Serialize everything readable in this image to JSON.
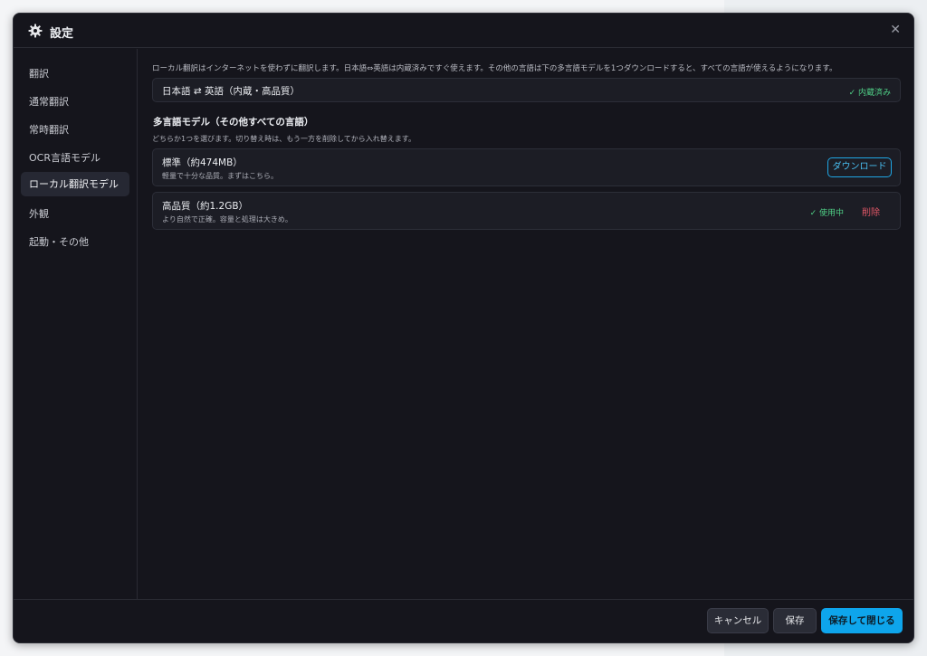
{
  "window": {
    "title": "設定",
    "close_glyph": "✕"
  },
  "sidebar": {
    "items": [
      {
        "label": "翻訳"
      },
      {
        "label": "通常翻訳"
      },
      {
        "label": "常時翻訳"
      },
      {
        "label": "OCR言語モデル"
      },
      {
        "label": "ローカル翻訳モデル",
        "active": true
      },
      {
        "label": "外観"
      },
      {
        "label": "起動・その他"
      }
    ]
  },
  "content": {
    "description": "ローカル翻訳はインターネットを使わずに翻訳します。日本語⇔英語は内蔵済みですぐ使えます。その他の言語は下の多言語モデルを1つダウンロードすると、すべての言語が使えるようになります。",
    "builtin": {
      "label": "日本語 ⇄ 英語（内蔵・高品質）",
      "status": "✓ 内蔵済み"
    },
    "multilingual": {
      "title": "多言語モデル（その他すべての言語）",
      "subtitle": "どちらか1つを選びます。切り替え時は、もう一方を削除してから入れ替えます。",
      "models": [
        {
          "name": "標準（約474MB）",
          "desc": "軽量で十分な品質。まずはこちら。",
          "action_label": "ダウンロード"
        },
        {
          "name": "高品質（約1.2GB）",
          "desc": "より自然で正確。容量と処理は大きめ。",
          "status": "✓ 使用中",
          "action_label": "削除"
        }
      ]
    }
  },
  "footer": {
    "cancel_label": "キャンセル",
    "save_label": "保存",
    "save_close_label": "保存して閉じる"
  },
  "colors": {
    "accent": "#0ea5ec",
    "success": "#4fcf86",
    "danger": "#e05767",
    "background": "#15151c"
  }
}
